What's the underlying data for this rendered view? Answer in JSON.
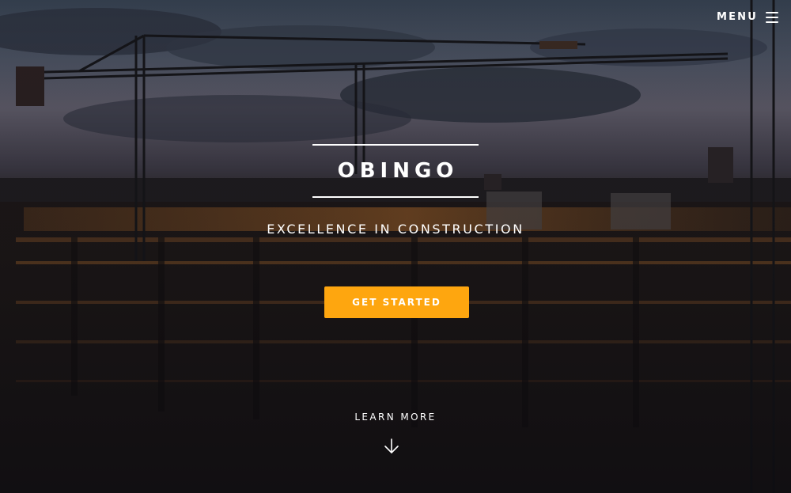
{
  "nav": {
    "menu_label": "MENU",
    "menu_icon": "hamburger-icon"
  },
  "hero": {
    "title": "OBINGO",
    "tagline": "EXCELLENCE IN CONSTRUCTION",
    "cta_label": "GET STARTED",
    "learn_more_label": "LEARN MORE",
    "scroll_icon": "arrow-down-icon"
  },
  "colors": {
    "accent": "#fea60f",
    "text": "#ffffff"
  }
}
